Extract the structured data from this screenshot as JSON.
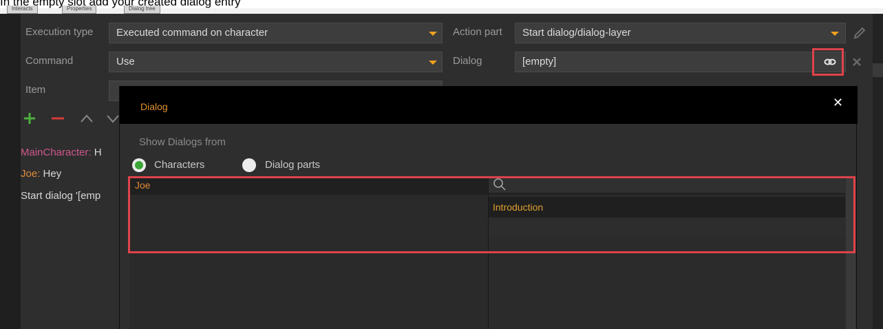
{
  "caption": "In the empty slot add your created dialog entry",
  "tabs": [
    "Interacts",
    "Properties",
    "Dialog tree"
  ],
  "form": {
    "execution_type_label": "Execution type",
    "execution_type_value": "Executed command on character",
    "command_label": "Command",
    "command_value": "Use",
    "item_label": "Item",
    "action_part_label": "Action part",
    "action_part_value": "Start dialog/dialog-layer",
    "dialog_label": "Dialog",
    "dialog_value": "[empty]"
  },
  "script_lines": [
    {
      "name": "MainCharacter",
      "sep": ": ",
      "text": "H"
    },
    {
      "name": "Joe",
      "sep": ": ",
      "text": "Hey"
    },
    {
      "name": "",
      "sep": "",
      "text": "Start dialog '[emp"
    }
  ],
  "dialog_window": {
    "title": "Dialog",
    "close_label": "✕",
    "show_from_label": "Show Dialogs from",
    "option_characters": "Characters",
    "option_dialog_parts": "Dialog parts",
    "selected_option": "Characters",
    "characters": [
      "Joe"
    ],
    "dialogs": [
      "Introduction"
    ]
  },
  "icons": {
    "pencil": "pencil-icon",
    "link": "link-icon",
    "clear": "close-icon",
    "add": "plus-icon",
    "remove": "minus-icon",
    "up": "chevron-up-icon",
    "down": "chevron-down-icon",
    "search": "search-icon"
  },
  "colors": {
    "accent_orange": "#e08a3a",
    "highlight_red": "#e0434b",
    "add_green": "#4caf3c",
    "remove_red": "#d63b3b",
    "radio_selected": "#3aa635"
  }
}
